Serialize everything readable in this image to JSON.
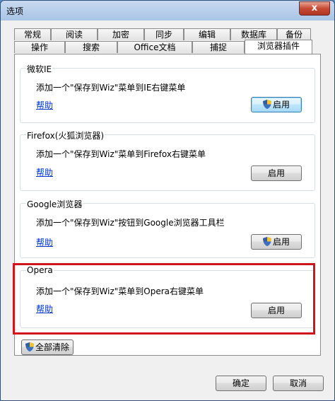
{
  "window": {
    "title": "选项",
    "close_label": "x"
  },
  "tabs_row1": [
    "常规",
    "阅读",
    "加密",
    "同步",
    "编辑",
    "数据库",
    "备份"
  ],
  "tabs_row2": [
    "操作",
    "搜索",
    "Office文档",
    "捕捉",
    "浏览器插件"
  ],
  "active_tab": "浏览器插件",
  "groups": [
    {
      "title": "微软IE",
      "description": "添加一个\"保存到Wiz\"菜单到IE右键菜单",
      "help": "帮助",
      "button": "启用",
      "shield": true
    },
    {
      "title": "Firefox(火狐浏览器)",
      "description": "添加一个\"保存到Wiz\"菜单到Firefox右键菜单",
      "help": "帮助",
      "button": "启用",
      "shield": false
    },
    {
      "title": "Google浏览器",
      "description": "添加一个\"保存到Wiz\"按钮到Google浏览器工具栏",
      "help": "帮助",
      "button": "启用",
      "shield": true
    },
    {
      "title": "Opera",
      "description": "添加一个\"保存到Wiz\"菜单到Opera右键菜单",
      "help": "帮助",
      "button": "启用",
      "shield": false
    }
  ],
  "clear_all_label": "全部清除",
  "ok_label": "确定",
  "cancel_label": "取消",
  "colors": {
    "highlight": "#d0161d",
    "link": "#0033cc"
  }
}
